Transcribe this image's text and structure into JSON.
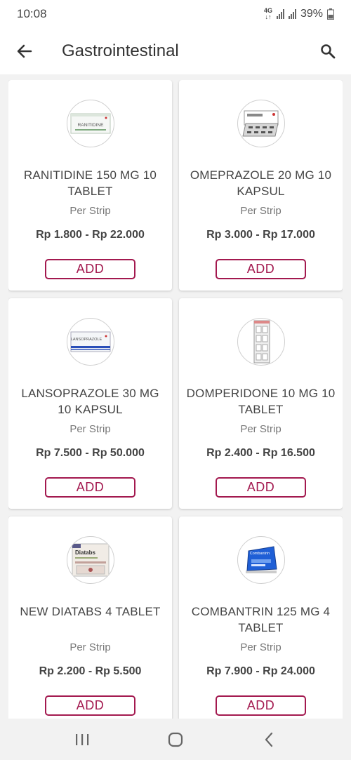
{
  "status_bar": {
    "time": "10:08",
    "network_top": "4G",
    "network_bottom": "↓↑",
    "battery": "39%"
  },
  "app_bar": {
    "title": "Gastrointestinal"
  },
  "products": [
    {
      "name": "RANITIDINE 150 MG 10 TABLET",
      "unit": "Per Strip",
      "price": "Rp 1.800 - Rp 22.000",
      "add_label": "ADD",
      "image_text": "RANITIDINE"
    },
    {
      "name": "OMEPRAZOLE 20 MG 10 KAPSUL",
      "unit": "Per Strip",
      "price": "Rp 3.000 - Rp 17.000",
      "add_label": "ADD"
    },
    {
      "name": "LANSOPRAZOLE 30 MG 10 KAPSUL",
      "unit": "Per Strip",
      "price": "Rp 7.500 - Rp 50.000",
      "add_label": "ADD",
      "image_text": "LANSOPRAZOLE"
    },
    {
      "name": "DOMPERIDONE 10 MG 10 TABLET",
      "unit": "Per Strip",
      "price": "Rp 2.400 - Rp 16.500",
      "add_label": "ADD"
    },
    {
      "name": "NEW DIATABS 4 TABLET",
      "unit": "Per Strip",
      "price": "Rp 2.200 - Rp 5.500",
      "add_label": "ADD",
      "image_text": "Diatabs"
    },
    {
      "name": "COMBANTRIN 125 MG 4 TABLET",
      "unit": "Per Strip",
      "price": "Rp 7.900 - Rp 24.000",
      "add_label": "ADD",
      "image_text": "Combantrin"
    }
  ],
  "icons": {
    "back": "arrow-left-icon",
    "search": "search-icon",
    "recents": "recent-apps-icon",
    "home": "home-icon",
    "nav_back": "nav-back-icon"
  },
  "colors": {
    "accent": "#a3194f",
    "background": "#f2f2f2"
  }
}
